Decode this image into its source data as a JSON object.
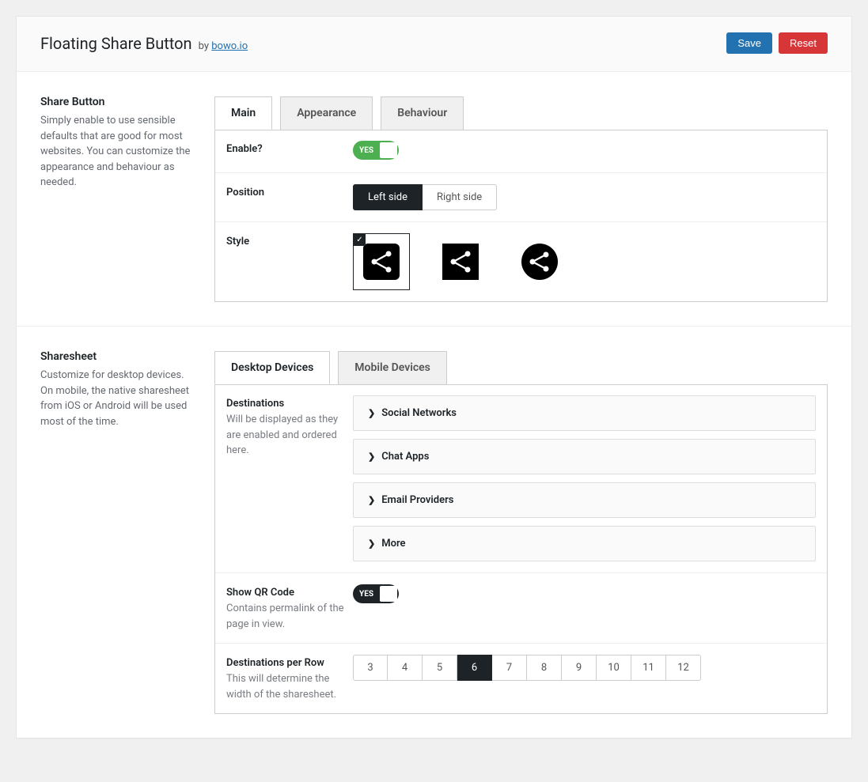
{
  "header": {
    "title": "Floating Share Button",
    "by": "by",
    "author": "bowo.io",
    "save": "Save",
    "reset": "Reset"
  },
  "sections": {
    "shareButton": {
      "title": "Share Button",
      "desc": "Simply enable to use sensible defaults that are good for most websites. You can customize the appearance and behaviour as needed.",
      "tabs": [
        "Main",
        "Appearance",
        "Behaviour"
      ],
      "activeTab": 0,
      "enable": {
        "label": "Enable?",
        "value": true,
        "yes": "YES",
        "color": "green"
      },
      "position": {
        "label": "Position",
        "options": [
          "Left side",
          "Right side"
        ],
        "active": 0
      },
      "style": {
        "label": "Style",
        "selected": 0,
        "options": [
          "rounded-square",
          "square",
          "circle"
        ]
      }
    },
    "sharesheet": {
      "title": "Sharesheet",
      "desc": "Customize for desktop devices. On mobile, the native sharesheet from iOS or Android will be used most of the time.",
      "tabs": [
        "Desktop Devices",
        "Mobile Devices"
      ],
      "activeTab": 0,
      "destinations": {
        "label": "Destinations",
        "desc": "Will be displayed as they are enabled and ordered here.",
        "items": [
          "Social Networks",
          "Chat Apps",
          "Email Providers",
          "More"
        ]
      },
      "qr": {
        "label": "Show QR Code",
        "desc": "Contains permalink of the page in view.",
        "value": true,
        "yes": "YES"
      },
      "perRow": {
        "label": "Destinations per Row",
        "desc": "This will determine the width of the sharesheet.",
        "options": [
          "3",
          "4",
          "5",
          "6",
          "7",
          "8",
          "9",
          "10",
          "11",
          "12"
        ],
        "active": 3
      }
    }
  }
}
